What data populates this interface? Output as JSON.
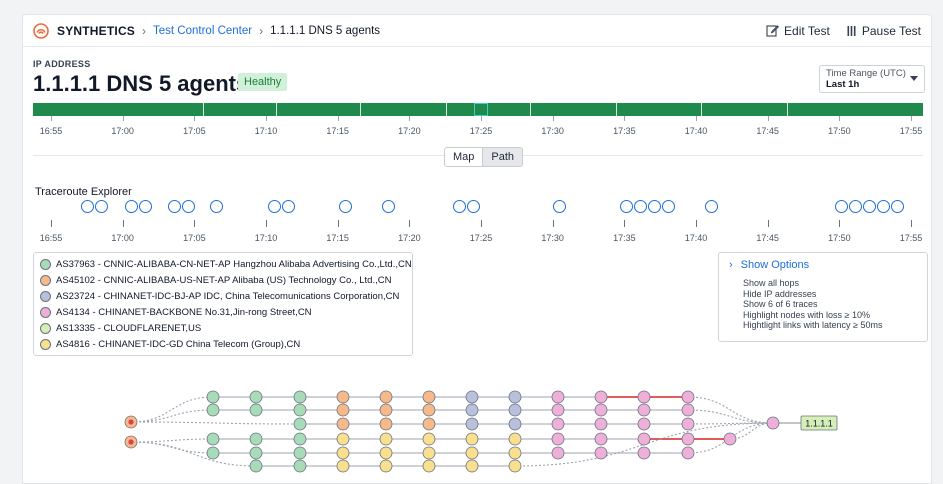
{
  "header": {
    "app_name": "SYNTHETICS",
    "breadcrumb_link": "Test Control Center",
    "breadcrumb_current": "1.1.1.1 DNS 5 agents",
    "edit_label": "Edit Test",
    "pause_label": "Pause Test",
    "brand_color": "#ea6b3d"
  },
  "test": {
    "type_label": "IP ADDRESS",
    "title": "1.1.1.1 DNS 5 agents",
    "status": "Healthy",
    "status_color": "#1a7f37"
  },
  "time_range": {
    "label": "Time Range (UTC)",
    "value": "Last 1h"
  },
  "health_timeline": {
    "bar_color": "#1f8a4c",
    "selected_tick": "17:25",
    "ticks": [
      "16:55",
      "17:00",
      "17:05",
      "17:10",
      "17:15",
      "17:20",
      "17:25",
      "17:30",
      "17:35",
      "17:40",
      "17:45",
      "17:50",
      "17:55"
    ]
  },
  "view_toggle": {
    "options": [
      "Map",
      "Path"
    ],
    "active": "Path"
  },
  "traceroute": {
    "title": "Traceroute Explorer",
    "ticks": [
      "16:55",
      "17:00",
      "17:05",
      "17:10",
      "17:15",
      "17:20",
      "17:25",
      "17:30",
      "17:35",
      "17:40",
      "17:45",
      "17:50",
      "17:55"
    ]
  },
  "legend": [
    {
      "label": "AS37963 - CNNIC-ALIBABA-CN-NET-AP Hangzhou Alibaba Advertising Co.,Ltd.,CN",
      "color": "#a8dcb8"
    },
    {
      "label": "AS45102 - CNNIC-ALIBABA-US-NET-AP Alibaba (US) Technology Co., Ltd.,CN",
      "color": "#f5b98a"
    },
    {
      "label": "AS23724 - CHINANET-IDC-BJ-AP IDC, China Telecomunications Corporation,CN",
      "color": "#b8c0db"
    },
    {
      "label": "AS4134 - CHINANET-BACKBONE No.31,Jin-rong Street,CN",
      "color": "#eeb0d8"
    },
    {
      "label": "AS13335 - CLOUDFLARENET,US",
      "color": "#d6eeb7"
    },
    {
      "label": "AS4816 - CHINANET-IDC-GD China Telecom (Group),CN",
      "color": "#f8e08f"
    }
  ],
  "options": {
    "toggle_label": "Show Options",
    "items": [
      "Show all hops",
      "Hide IP addresses",
      "Show 6 of 6 traces",
      "Highlight nodes with loss ≥ 10%",
      "Hightlight links with latency ≥ 50ms"
    ]
  },
  "path": {
    "destination": "1.1.1.1",
    "loss_link_color": "#d94545"
  }
}
